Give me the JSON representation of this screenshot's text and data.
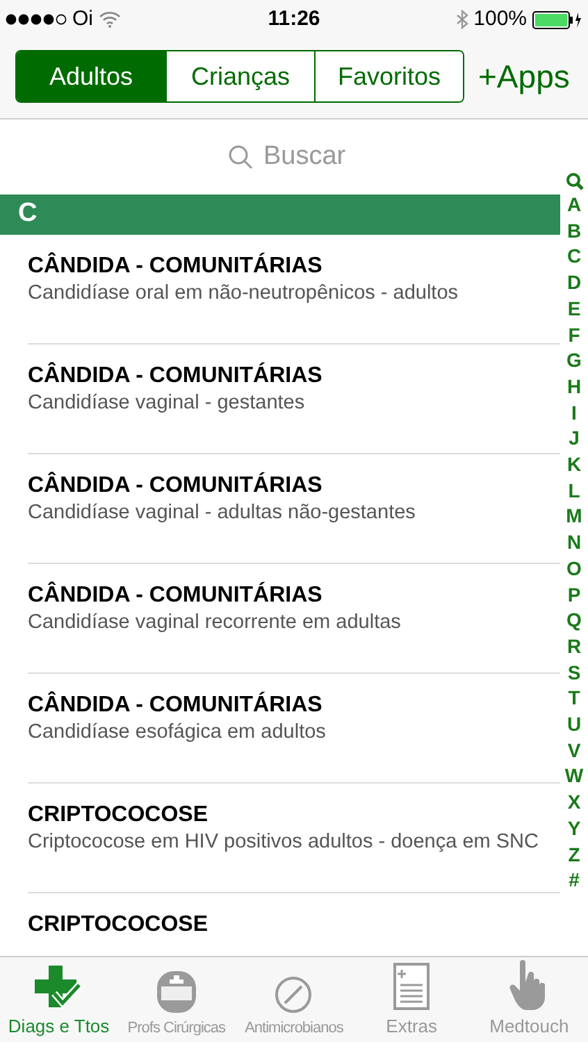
{
  "status_bar": {
    "carrier": "Oi",
    "time": "11:26",
    "battery": "100%"
  },
  "segments": [
    {
      "label": "Adultos",
      "selected": true
    },
    {
      "label": "Crianças",
      "selected": false
    },
    {
      "label": "Favoritos",
      "selected": false
    }
  ],
  "apps_button": "+Apps",
  "search": {
    "placeholder": "Buscar"
  },
  "section": {
    "title": "C"
  },
  "rows": [
    {
      "title": "CÂNDIDA - COMUNITÁRIAS",
      "subtitle": "Candidíase oral em não-neutropênicos - adultos"
    },
    {
      "title": "CÂNDIDA - COMUNITÁRIAS",
      "subtitle": "Candidíase vaginal - gestantes"
    },
    {
      "title": "CÂNDIDA - COMUNITÁRIAS",
      "subtitle": "Candidíase vaginal - adultas não-gestantes"
    },
    {
      "title": "CÂNDIDA - COMUNITÁRIAS",
      "subtitle": "Candidíase vaginal recorrente em adultas"
    },
    {
      "title": "CÂNDIDA - COMUNITÁRIAS",
      "subtitle": "Candidíase esofágica em adultos"
    },
    {
      "title": "CRIPTOCOCOSE",
      "subtitle": "Criptococose em HIV positivos adultos - doença em SNC"
    },
    {
      "title": "CRIPTOCOCOSE"
    }
  ],
  "index": [
    "A",
    "B",
    "C",
    "D",
    "E",
    "F",
    "G",
    "H",
    "I",
    "J",
    "K",
    "L",
    "M",
    "N",
    "O",
    "P",
    "Q",
    "R",
    "S",
    "T",
    "U",
    "V",
    "W",
    "X",
    "Y",
    "Z",
    "#"
  ],
  "tab_bar": [
    {
      "kind": "cross",
      "label": "Diags e Ttos",
      "selected": true
    },
    {
      "kind": "helmet",
      "label": "Profs Cirúrgicas",
      "selected": false
    },
    {
      "kind": "pill",
      "label": "Antimicrobianos",
      "selected": false
    },
    {
      "kind": "sheet",
      "label": "Extras",
      "selected": false
    },
    {
      "kind": "hand",
      "label": "Medtouch",
      "selected": false
    }
  ]
}
